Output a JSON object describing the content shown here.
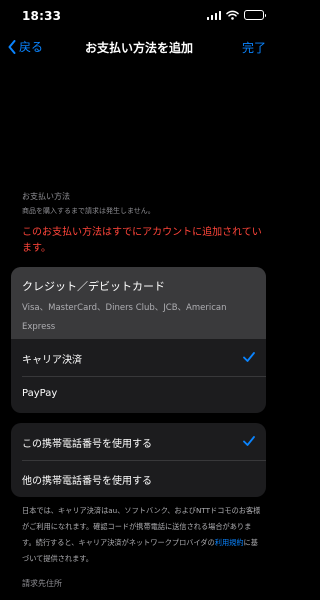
{
  "status": {
    "time": "18:33"
  },
  "nav": {
    "back_label": "戻る",
    "title": "お支払い方法を追加",
    "done_label": "完了"
  },
  "payment": {
    "caption": "お支払い方法",
    "note": "商品を購入するまで請求は発生しません。",
    "error": "このお支払い方法はすでにアカウントに追加されています。",
    "card": {
      "title": "クレジット／デビットカード",
      "brands": "Visa、MasterCard、Diners Club、JCB、American Express"
    },
    "carrier": {
      "label": "キャリア決済",
      "selected": true
    },
    "paypay": {
      "label": "PayPay"
    }
  },
  "phone": {
    "use_current": {
      "label": "この携帯電話番号を使用する",
      "selected": true
    },
    "use_other": {
      "label": "他の携帯電話番号を使用する"
    }
  },
  "info": {
    "text_before": "日本では、キャリア決済はau、ソフトバンク、およびNTTドコモのお客様がご利用になれます。確認コードが携帯電話に送信される場合があります。続行すると、キャリア決済がネットワークプロバイダの",
    "link": "利用規約",
    "text_after": "に基づいて提供されます。"
  },
  "billing": {
    "caption": "請求先住所"
  },
  "colors": {
    "accent": "#0a84ff",
    "error": "#ff453a",
    "selected_row": "#3a3a3c",
    "group_bg": "#1c1c1e"
  },
  "icons": [
    "signal-icon",
    "wifi-icon",
    "battery-icon",
    "back-chevron-icon",
    "checkmark-icon"
  ]
}
